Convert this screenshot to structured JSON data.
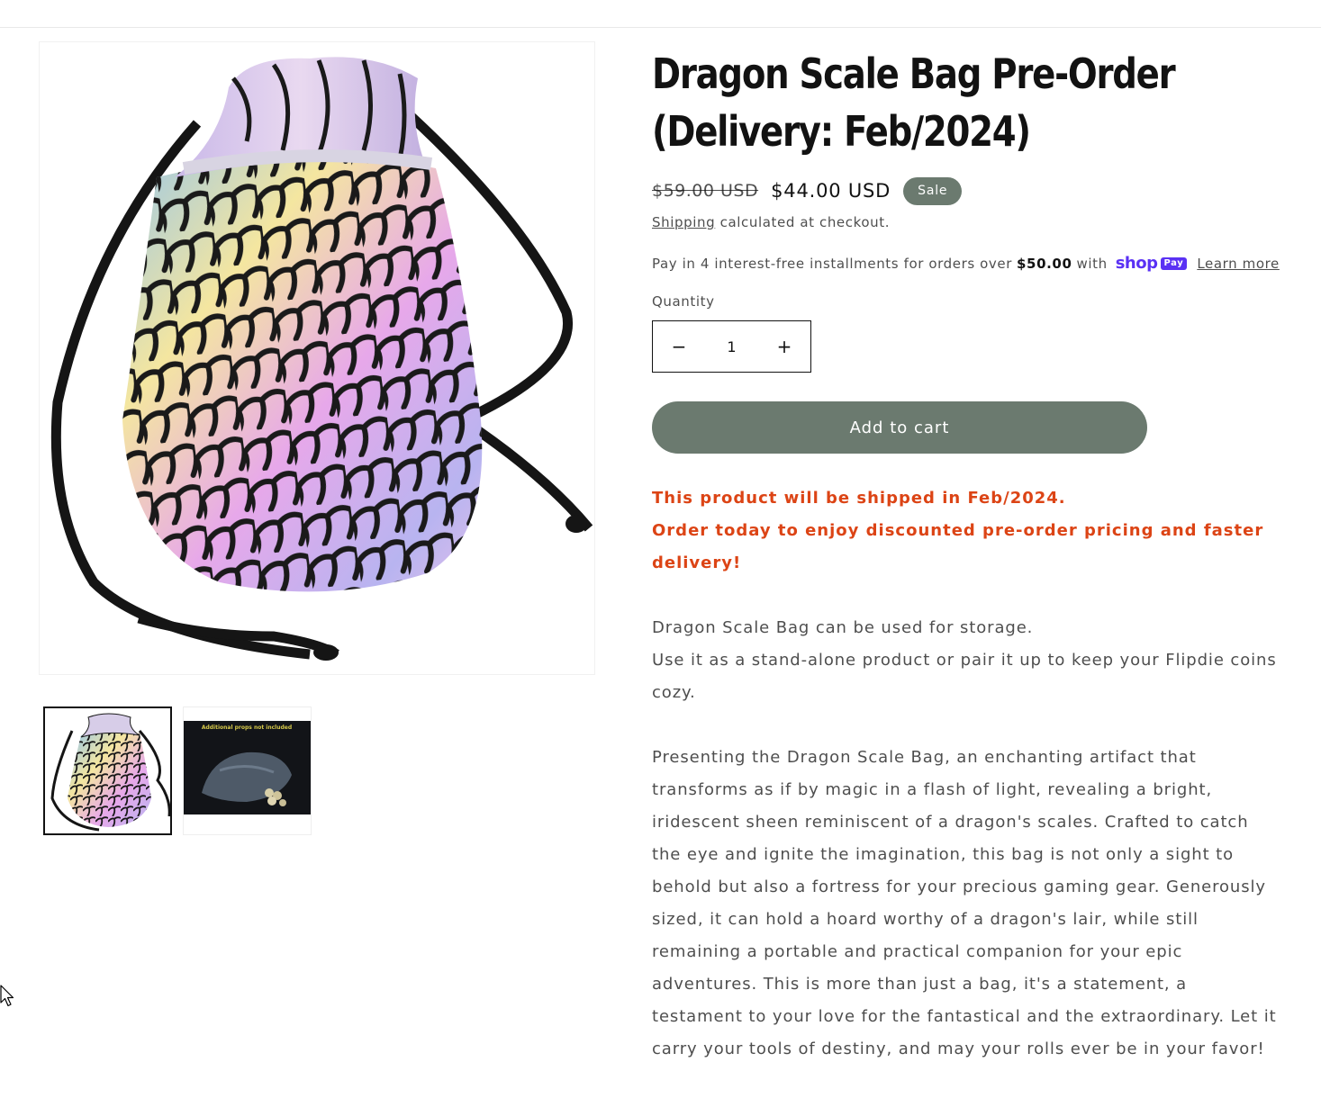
{
  "product": {
    "title": "Dragon Scale Bag Pre-Order (Delivery: Feb/2024)",
    "price_regular": "$59.00 USD",
    "price_sale": "$44.00 USD",
    "sale_badge": "Sale"
  },
  "shipping": {
    "link": "Shipping",
    "text": " calculated at checkout."
  },
  "installments": {
    "text_before": "Pay in 4 interest-free installments for orders over",
    "threshold": "$50.00",
    "text_after": "with",
    "shop_word": "shop",
    "pay_word": "Pay",
    "learn_more": "Learn more"
  },
  "quantity": {
    "label": "Quantity",
    "value": "1",
    "decrease": "−",
    "increase": "+"
  },
  "add_to_cart": "Add to cart",
  "notice": {
    "line1": "This product will be shipped in Feb/2024.",
    "line2": "Order today to enjoy discounted pre-order pricing and faster delivery!"
  },
  "description": {
    "p1_line1": "Dragon Scale Bag can be used for storage.",
    "p1_line2": "Use it as a stand-alone product or pair it up to keep your Flipdie coins cozy.",
    "p2": "Presenting the Dragon Scale Bag, an enchanting artifact that transforms as if by magic in a flash of light, revealing a bright, iridescent sheen reminiscent of a dragon's scales. Crafted to catch the eye and ignite the imagination, this bag is not only a sight to behold but also a fortress for your precious gaming gear. Generously sized, it can hold a hoard worthy of a dragon's lair, while still remaining a portable and practical companion for your epic adventures. This is more than just a bag, it's a statement, a testament to your love for the fantastical and the extraordinary. Let it carry your tools of destiny, and may your rolls ever be in your favor!"
  },
  "thumbnails": {
    "thumb2_caption": "Additional props not included"
  }
}
